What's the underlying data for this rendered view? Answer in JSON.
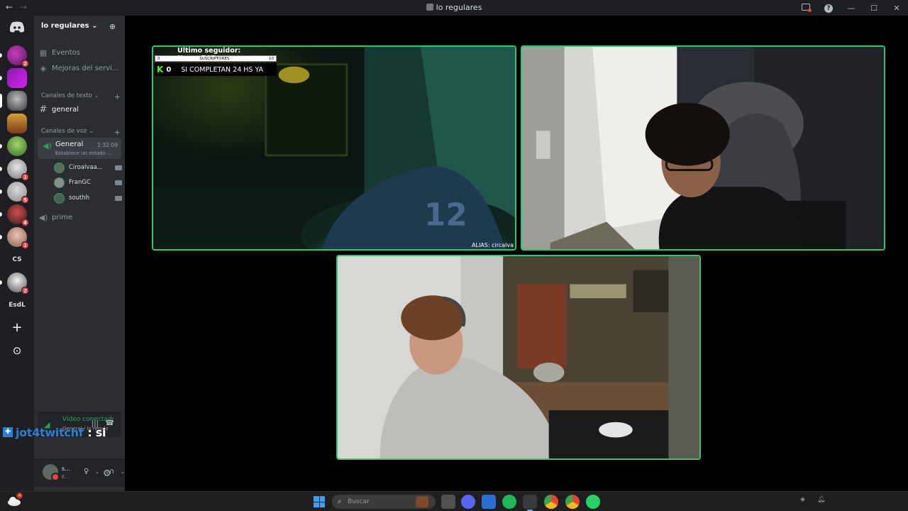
{
  "window": {
    "title": "lo regulares",
    "back": "←",
    "forward": "→"
  },
  "rail": {
    "text_servers": [
      "CS",
      "EsdL"
    ],
    "badges": [
      "2",
      "1",
      "5",
      "4",
      "1",
      "2"
    ],
    "add_glyph": "+",
    "explore_glyph": "⊙"
  },
  "guild": {
    "name": "lo regulares ⌄",
    "items": [
      {
        "label": "Eventos"
      },
      {
        "label": "Mejoras del servi..."
      }
    ],
    "text_category": "Canales de texto ⌄",
    "text_channels": [
      {
        "label": "general"
      }
    ],
    "voice_category": "Canales de voz ⌄",
    "voice_channel": {
      "name": "General",
      "time": "1:32:09",
      "status": "Establece un estado ..."
    },
    "voice_users": [
      {
        "name": "Ciroalvaa..."
      },
      {
        "name": "FranGC"
      },
      {
        "name": "southh"
      }
    ],
    "other_voice": [
      {
        "label": "prime"
      }
    ]
  },
  "voice_panel": {
    "status": "Vídeo conectado",
    "location": "General / lo regula..."
  },
  "overlay": {
    "handle": "jot4twitchf",
    "message": ": si"
  },
  "user_panel": {
    "name": "s...",
    "status": "E..."
  },
  "stream_hud": {
    "last_follower": "Ultimo seguidor: Nanox747",
    "bar_left": "0",
    "bar_label": "SUSCRIPTORES",
    "bar_right": "10",
    "kick_count": "0",
    "goal_text": "SI COMPLETAN 24 HS YA",
    "alias": "ALIAS: circalva"
  },
  "taskbar": {
    "search_placeholder": "Buscar",
    "weather_badge": "4"
  },
  "colors": {
    "speaking_border": "#2dc770",
    "accent_green": "#23a55a",
    "badge_red": "#f23f43",
    "overlay_blue": "#2a7fd4"
  }
}
